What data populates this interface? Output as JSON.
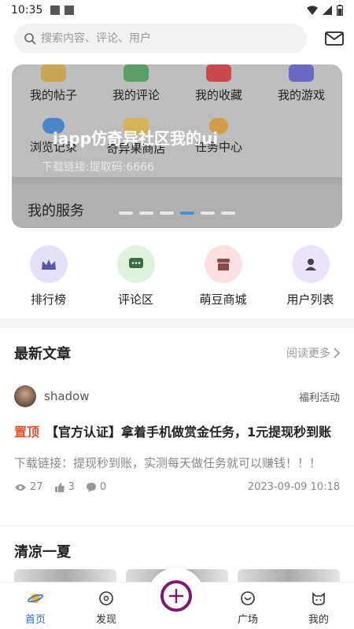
{
  "status": {
    "time": "10:35"
  },
  "search": {
    "placeholder": "搜索内容、评论、用户"
  },
  "banner": {
    "grid_row1": [
      "我的帖子",
      "我的评论",
      "我的收藏",
      "我的游戏"
    ],
    "grid_row2": [
      "浏览记录",
      "奇异果商店",
      "任务中心"
    ],
    "title": "iapp仿奇异社区我的ui",
    "subtitle": "下载链接:提取码:6666",
    "services_label": "我的服务",
    "active_dot": 3
  },
  "quick": [
    {
      "label": "排行榜",
      "icon": "crown-icon",
      "bg": "#e3e2f7"
    },
    {
      "label": "评论区",
      "icon": "comment-icon",
      "bg": "#dff3df"
    },
    {
      "label": "萌豆商城",
      "icon": "shop-icon",
      "bg": "#fbe1e1"
    },
    {
      "label": "用户列表",
      "icon": "user-icon",
      "bg": "#ebe3f8"
    }
  ],
  "latest": {
    "title": "最新文章",
    "more": "阅读更多",
    "post": {
      "author": "shadow",
      "tag": "福利活动",
      "pin": "置顶",
      "title": "【官方认证】拿着手机做赏金任务，1元提现秒到账",
      "body": "下载链接：提现秒到账，实测每天做任务就可以赚钱！！！",
      "views": "27",
      "likes": "3",
      "comments": "0",
      "date": "2023-09-09 10:18"
    }
  },
  "section2": {
    "title": "清凉一夏"
  },
  "tabs": [
    {
      "label": "首页",
      "icon": "planet-icon",
      "active": true
    },
    {
      "label": "发现",
      "icon": "compass-icon",
      "active": false
    },
    {
      "label": "广场",
      "icon": "square-icon",
      "active": false
    },
    {
      "label": "我的",
      "icon": "cat-icon",
      "active": false
    }
  ],
  "colors": {
    "accent": "#2d6fd6",
    "pin": "#e8502d",
    "fab": "#7b1a6e"
  }
}
